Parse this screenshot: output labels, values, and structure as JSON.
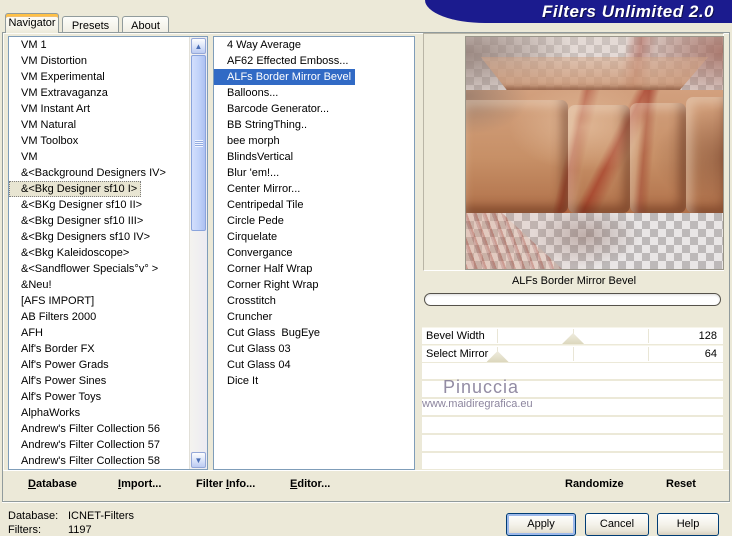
{
  "title": "Filters Unlimited 2.0",
  "tabs": [
    {
      "label": "Navigator"
    },
    {
      "label": "Presets"
    },
    {
      "label": "About"
    }
  ],
  "category_list": {
    "items": [
      "VM 1",
      "VM Distortion",
      "VM Experimental",
      "VM Extravaganza",
      "VM Instant Art",
      "VM Natural",
      "VM Toolbox",
      "VM",
      "&<Background Designers IV>",
      "&<Bkg Designer sf10 I>",
      "&<BKg Designer sf10 II>",
      "&<Bkg Designer sf10 III>",
      "&<Bkg Designers sf10 IV>",
      "&<Bkg Kaleidoscope>",
      "&<Sandflower Specials°v° >",
      "&Neu!",
      "[AFS IMPORT]",
      "AB Filters 2000",
      "AFH",
      "Alf's Border FX",
      "Alf's Power Grads",
      "Alf's Power Sines",
      "Alf's Power Toys",
      "AlphaWorks",
      "Andrew's Filter Collection 56",
      "Andrew's Filter Collection 57",
      "Andrew's Filter Collection 58"
    ],
    "selected_index": 9
  },
  "filter_list": {
    "items": [
      "4 Way Average",
      "AF62 Effected Emboss...",
      "ALFs Border Mirror Bevel",
      "Balloons...",
      "Barcode Generator...",
      "BB StringThing..",
      "bee morph",
      "BlindsVertical",
      "Blur 'em!...",
      "Center Mirror...",
      "Centripedal Tile",
      "Circle Pede",
      "Cirquelate",
      "Convergance",
      "Corner Half Wrap",
      "Corner Right Wrap",
      "Crosstitch",
      "Cruncher",
      "Cut Glass  BugEye",
      "Cut Glass 03",
      "Cut Glass 04",
      "Dice It"
    ],
    "selected_index": 2
  },
  "preview": {
    "filter_name": "ALFs Border Mirror Bevel",
    "watermark_title": "Pinuccia",
    "watermark_url": "www.maidiregrafica.eu"
  },
  "sliders": [
    {
      "label": "Bevel Width",
      "value": "128",
      "position_pct": 50.2
    },
    {
      "label": "Select Mirror",
      "value": "64",
      "position_pct": 25.1
    }
  ],
  "toolbar": {
    "database": {
      "pre": "",
      "u": "D",
      "post": "atabase"
    },
    "import": {
      "pre": "",
      "u": "I",
      "post": "mport..."
    },
    "filter_info": {
      "pre": "Filter ",
      "u": "I",
      "post": "nfo..."
    },
    "editor": {
      "pre": "",
      "u": "E",
      "post": "ditor..."
    },
    "randomize": "Randomize",
    "reset": "Reset"
  },
  "status": {
    "database_label": "Database:",
    "database_value": "ICNET-Filters",
    "filters_label": "Filters:",
    "filters_value": "1197"
  },
  "action_buttons": {
    "apply": "Apply",
    "cancel": "Cancel",
    "help": "Help"
  },
  "icons": {
    "scroll_up": "▲",
    "scroll_down": "▼"
  },
  "colors": {
    "background": "#ece9d8",
    "banner_navy": "#1b1b8e",
    "selection_blue": "#316ac5",
    "tab_accent_orange": "#e78a00"
  }
}
